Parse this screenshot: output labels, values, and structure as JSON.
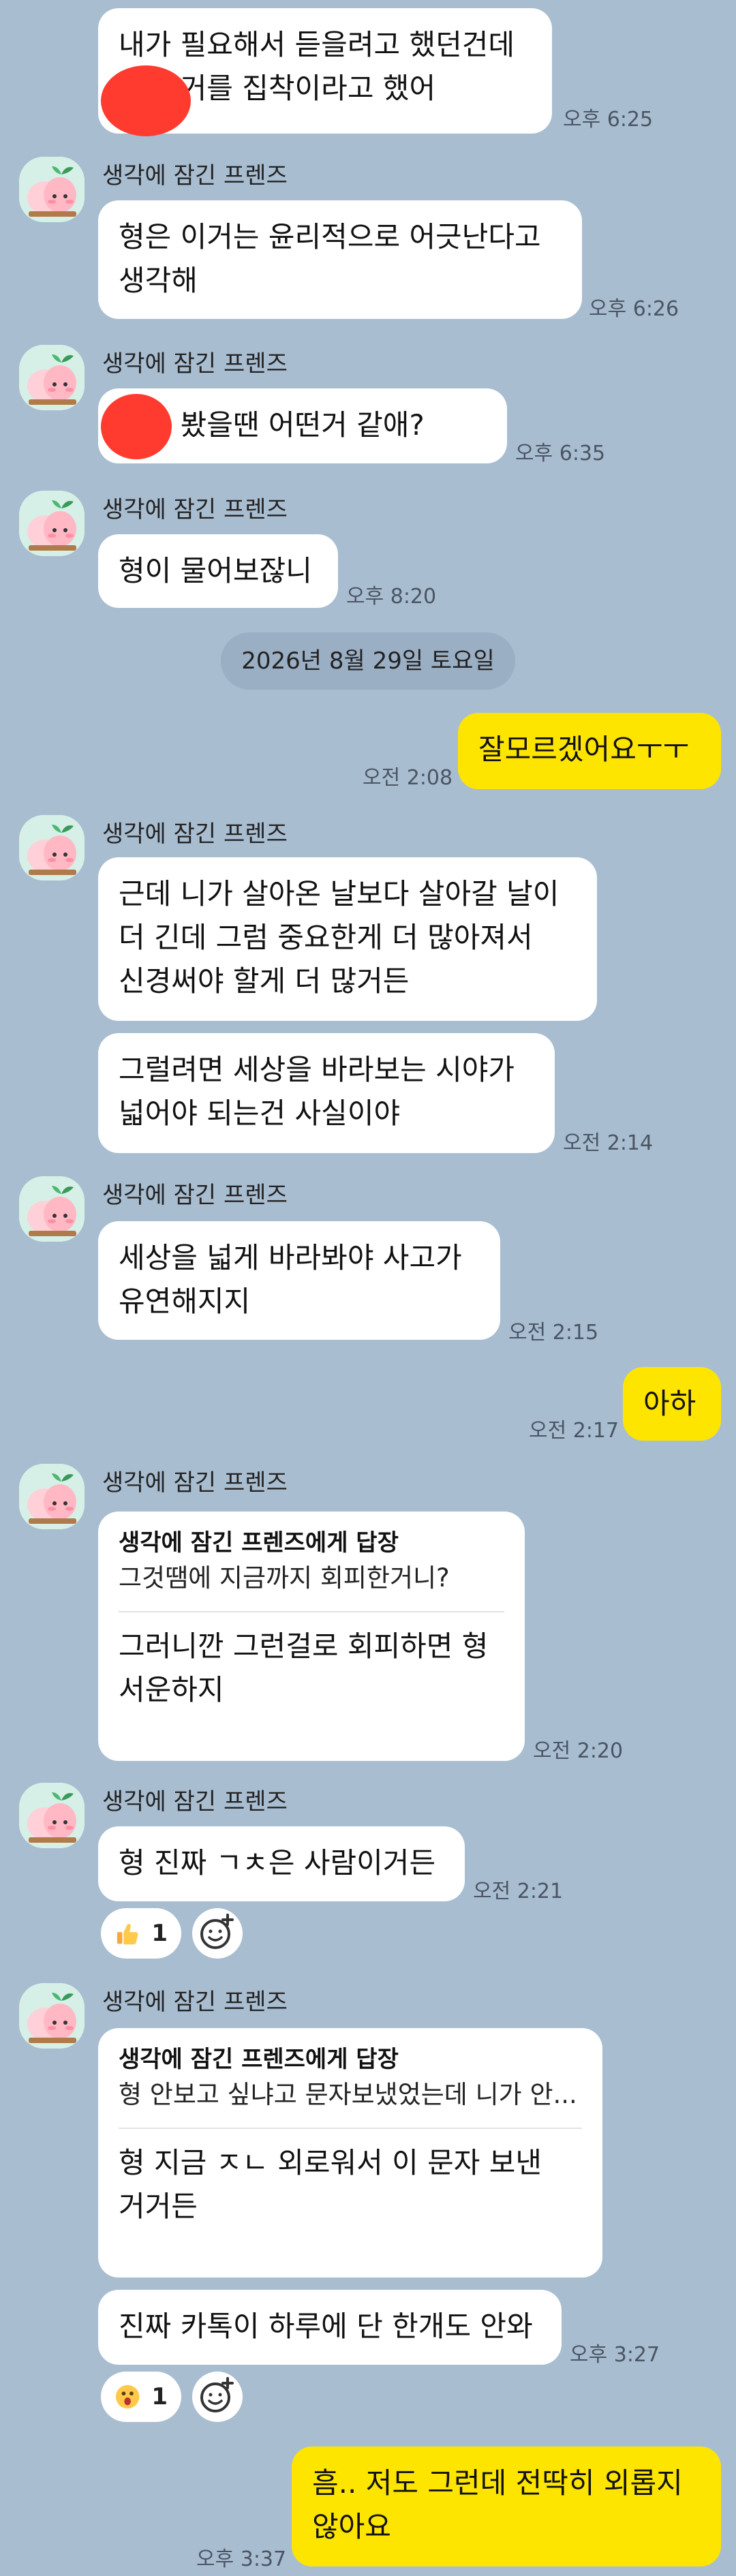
{
  "messages": {
    "m1": {
      "text": "내가 필요해서 듣을려고 했던건데\n         은 그거를 집착이라고 했어",
      "time": "오후 6:25"
    },
    "m2": {
      "sender": "생각에 잠긴 프렌즈",
      "text": "형은 이거는 윤리적으로 어긋난다고\n생각해",
      "time": "오후 6:26"
    },
    "m3": {
      "sender": "생각에 잠긴 프렌즈",
      "text": "       이가 봤을땐 어떤거 같애?",
      "time": "오후 6:35"
    },
    "m4": {
      "sender": "생각에 잠긴 프렌즈",
      "text": "형이 물어보잖니",
      "time": "오후 8:20"
    },
    "date_divider": "2026년 8월 29일 토요일",
    "m5": {
      "text": "잘모르겠어요ㅜㅜ",
      "time": "오전 2:08"
    },
    "m6": {
      "sender": "생각에 잠긴 프렌즈",
      "text": "근데 니가 살아온 날보다 살아갈 날이\n더 긴데 그럼 중요한게 더 많아져서\n신경써야 할게 더 많거든"
    },
    "m7": {
      "text": "그럴려면 세상을 바라보는 시야가\n넓어야 되는건 사실이야",
      "time": "오전 2:14"
    },
    "m8": {
      "sender": "생각에 잠긴 프렌즈",
      "text": "세상을 넓게 바라봐야 사고가\n유연해지지",
      "time": "오전 2:15"
    },
    "m9": {
      "text": "아하",
      "time": "오전 2:17"
    },
    "m10": {
      "sender": "생각에 잠긴 프렌즈",
      "reply_head": "생각에 잠긴 프렌즈에게 답장",
      "reply_quote": "그것땜에 지금까지 회피한거니?",
      "text": "그러니깐 그런걸로 회피하면 형\n서운하지",
      "time": "오전 2:20"
    },
    "m11": {
      "sender": "생각에 잠긴 프렌즈",
      "text": "형 진짜 ㄱㅊ은 사람이거든",
      "time": "오전 2:21",
      "reaction_count": "1"
    },
    "m12": {
      "sender": "생각에 잠긴 프렌즈",
      "reply_head": "생각에 잠긴 프렌즈에게 답장",
      "reply_quote": "형 안보고 싶냐고 문자보냈었는데 니가 안...",
      "text": "형 지금 ㅈㄴ 외로워서 이 문자 보낸\n거거든"
    },
    "m13": {
      "text": "진짜 카톡이 하루에 단 한개도 안와",
      "time": "오후 3:27",
      "reaction_count": "1"
    },
    "m14": {
      "text": "흠.. 저도 그런데 전딱히 외롭지\n않아요",
      "time": "오후 3:37"
    }
  },
  "icons": {
    "avatar": "peach-friend-avatar",
    "thumbs": "thumbs-up-icon",
    "surprised": "surprised-face-icon",
    "add_reaction": "add-reaction-icon"
  },
  "colors": {
    "background": "#a9bdd1",
    "my_bubble": "#fee500",
    "redaction": "#ff3b30"
  }
}
